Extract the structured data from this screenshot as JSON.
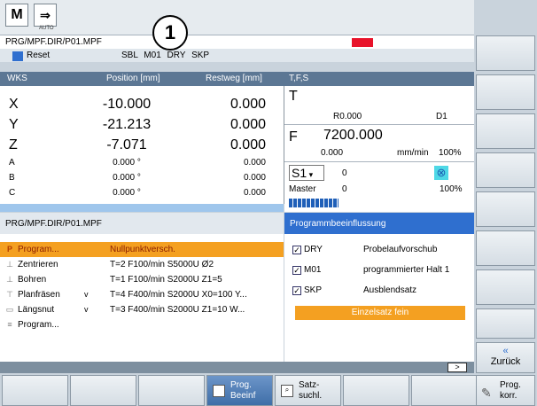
{
  "topbar": {
    "mode_icon": "M",
    "jog_label": "AUTO",
    "callout": "1"
  },
  "path": "PRG/MPF.DIR/P01.MPF",
  "status": {
    "reset": "Reset",
    "modes": "SBL  M01  DRY  SKP"
  },
  "wks": {
    "header": {
      "title": "WKS",
      "position": "Position [mm]",
      "rest": "Restweg [mm]"
    },
    "axes": [
      {
        "name": "X",
        "pos": "-10.000",
        "rest": "0.000",
        "size": "big"
      },
      {
        "name": "Y",
        "pos": "-21.213",
        "rest": "0.000",
        "size": "big"
      },
      {
        "name": "Z",
        "pos": "-7.071",
        "rest": "0.000",
        "size": "big"
      },
      {
        "name": "A",
        "pos": "0.000 °",
        "rest": "0.000",
        "size": "small"
      },
      {
        "name": "B",
        "pos": "0.000 °",
        "rest": "0.000",
        "size": "small"
      },
      {
        "name": "C",
        "pos": "0.000 °",
        "rest": "0.000",
        "size": "small"
      }
    ]
  },
  "tfs": {
    "header": "T,F,S",
    "t_label": "T",
    "r_value": "R0.000",
    "d_value": "D1",
    "f_label": "F",
    "f_value": "7200.000",
    "f_actual": "0.000",
    "f_unit": "mm/min",
    "f_percent": "100%",
    "spindle": "S1",
    "spindle_value": "0",
    "master_label": "Master",
    "master_value": "0",
    "spindle_percent": "100%"
  },
  "program": {
    "header": "PRG/MPF.DIR/P01.MPF",
    "rows": [
      {
        "icon": "P",
        "name": "Program...",
        "v": "",
        "desc": "Nullpunktversch.",
        "selected": true
      },
      {
        "icon": "",
        "name": "Zentrieren",
        "v": "",
        "desc": "T=2 F100/min S5000U Ø2",
        "selected": false
      },
      {
        "icon": "",
        "name": "Bohren",
        "v": "",
        "desc": "T=1 F100/min S2000U Z1=5",
        "selected": false
      },
      {
        "icon": "",
        "name": "Planfräsen",
        "v": "v",
        "desc": "T=4 F400/min S2000U X0=100 Y...",
        "selected": false
      },
      {
        "icon": "",
        "name": "Längsnut",
        "v": "v",
        "desc": "T=3 F400/min S2000U Z1=10 W...",
        "selected": false
      },
      {
        "icon": "",
        "name": "Program...",
        "v": "",
        "desc": "",
        "selected": false
      }
    ]
  },
  "influence": {
    "header": "Programmbeeinflussung",
    "options": [
      {
        "code": "DRY",
        "desc": "Probelaufvorschub",
        "checked": true
      },
      {
        "code": "M01",
        "desc": "programmierter Halt 1",
        "checked": true
      },
      {
        "code": "SKP",
        "desc": "Ausblendsatz",
        "checked": true
      }
    ],
    "single_block": "Einzelsatz fein"
  },
  "footer": {
    "more": ">"
  },
  "right_keys": {
    "back": "Zurück",
    "back_arrow": "«"
  },
  "bottom_keys": {
    "prog_beeinf": "Prog. Beeinf",
    "satz_suchl": "Satz- suchl.",
    "prog_korr": "Prog. korr."
  },
  "colors": {
    "accent": "#2f6fcf",
    "highlight": "#f4a021",
    "alarm": "#e8132a"
  }
}
